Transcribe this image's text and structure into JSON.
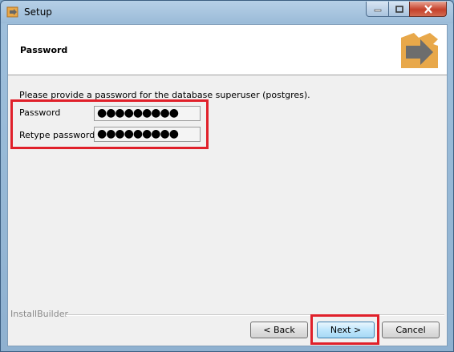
{
  "window": {
    "title": "Setup",
    "controls": {
      "minimize": "minimize",
      "maximize": "maximize",
      "close": "close"
    }
  },
  "header": {
    "title": "Password"
  },
  "form": {
    "prompt": "Please provide a password for the database superuser (postgres).",
    "password_label": "Password",
    "password_value": "●●●●●●●●●",
    "retype_label": "Retype password",
    "retype_value": "●●●●●●●●●"
  },
  "footer": {
    "brand": "InstallBuilder",
    "back_label": "< Back",
    "next_label": "Next >",
    "cancel_label": "Cancel"
  },
  "colors": {
    "highlight": "#e0202a",
    "logo_orange": "#e8a84a",
    "logo_arrow": "#6d6d6d"
  }
}
